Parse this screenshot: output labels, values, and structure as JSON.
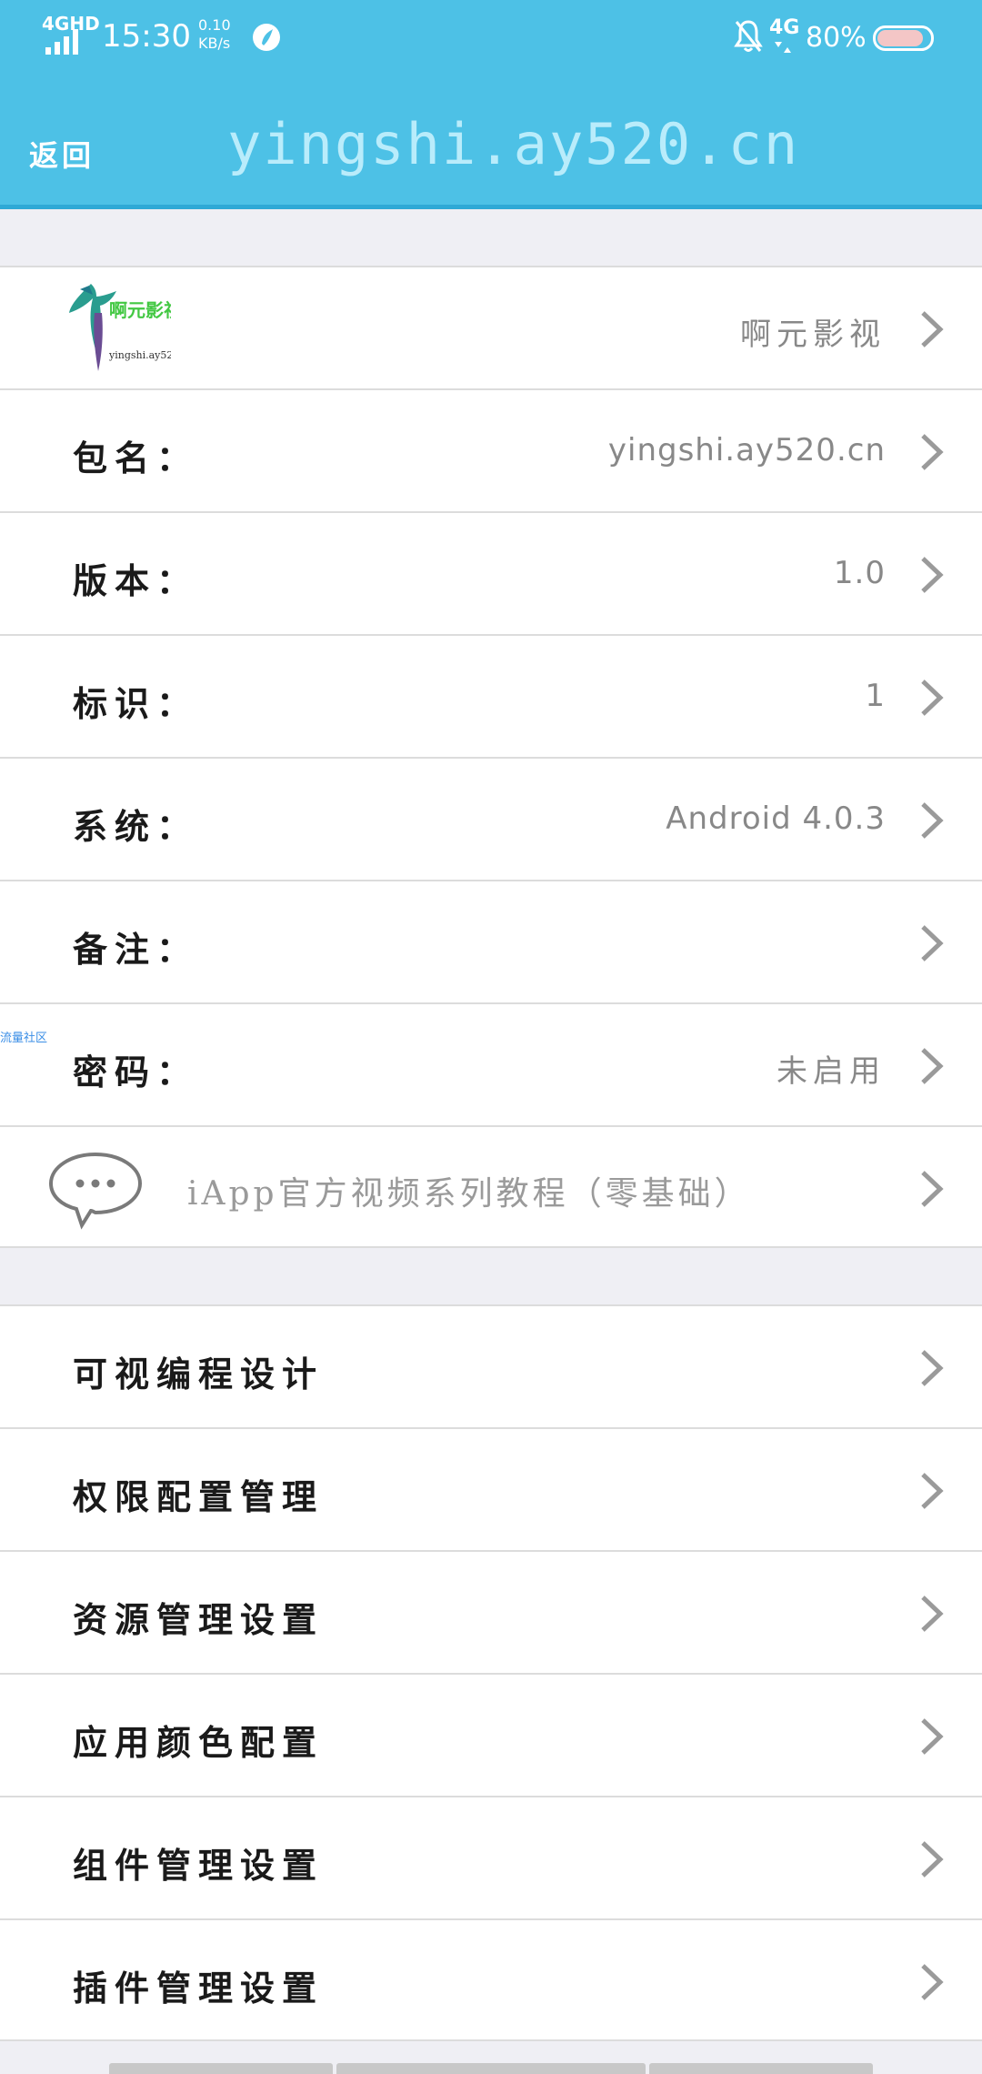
{
  "status_bar": {
    "network_label": "4GHD",
    "time": "15:30",
    "speed_value": "0.10",
    "speed_unit": "KB/s",
    "mobile_label": "4G",
    "battery": "80%"
  },
  "title_bar": {
    "back_label": "返回",
    "title": "yingshi.ay520.cn"
  },
  "info_list": {
    "app_row": {
      "value": "啊元影视",
      "logo_icon": "hummingbird-logo-icon"
    },
    "rows": [
      {
        "label": "包名：",
        "value": "yingshi.ay520.cn"
      },
      {
        "label": "版本：",
        "value": "1.0"
      },
      {
        "label": "标识：",
        "value": "1"
      },
      {
        "label": "系统：",
        "value": "Android 4.0.3"
      },
      {
        "label": "备注：",
        "value": ""
      },
      {
        "label": "密码：",
        "value": "未启用"
      }
    ],
    "tutorial": {
      "text": "iApp官方视频系列教程（零基础）",
      "icon": "chat-bubble-icon"
    }
  },
  "side_tag": "流量社区",
  "settings_list": {
    "rows": [
      {
        "label": "可视编程设计"
      },
      {
        "label": "权限配置管理"
      },
      {
        "label": "资源管理设置"
      },
      {
        "label": "应用颜色配置"
      },
      {
        "label": "组件管理设置"
      },
      {
        "label": "插件管理设置"
      }
    ]
  },
  "colors": {
    "header": "#4dc1e6",
    "header_border": "#2ea9d6",
    "background": "#efeff4",
    "value_text": "#888888"
  }
}
